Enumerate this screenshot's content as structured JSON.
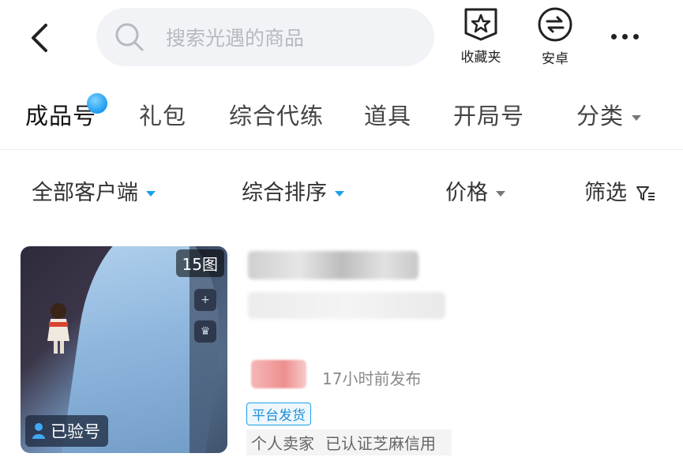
{
  "search": {
    "placeholder": "搜索光遇的商品"
  },
  "header": {
    "favorites_label": "收藏夹",
    "android_label": "安卓"
  },
  "tabs": [
    {
      "label": "成品号",
      "active": true,
      "has_dot": true
    },
    {
      "label": "礼包"
    },
    {
      "label": "综合代练"
    },
    {
      "label": "道具"
    },
    {
      "label": "开局号"
    },
    {
      "label": "分类",
      "dropdown": true
    }
  ],
  "filters": {
    "client": "全部客户端",
    "sort": "综合排序",
    "price": "价格",
    "screen": "筛选"
  },
  "listing": {
    "image_count": "15图",
    "verified": "已验号",
    "posted_time": "17小时前发布",
    "tag": "平台发货",
    "seller_type": "个人卖家",
    "seller_cert": "已认证芝麻信用"
  },
  "colors": {
    "accent": "#1e9fe8"
  }
}
